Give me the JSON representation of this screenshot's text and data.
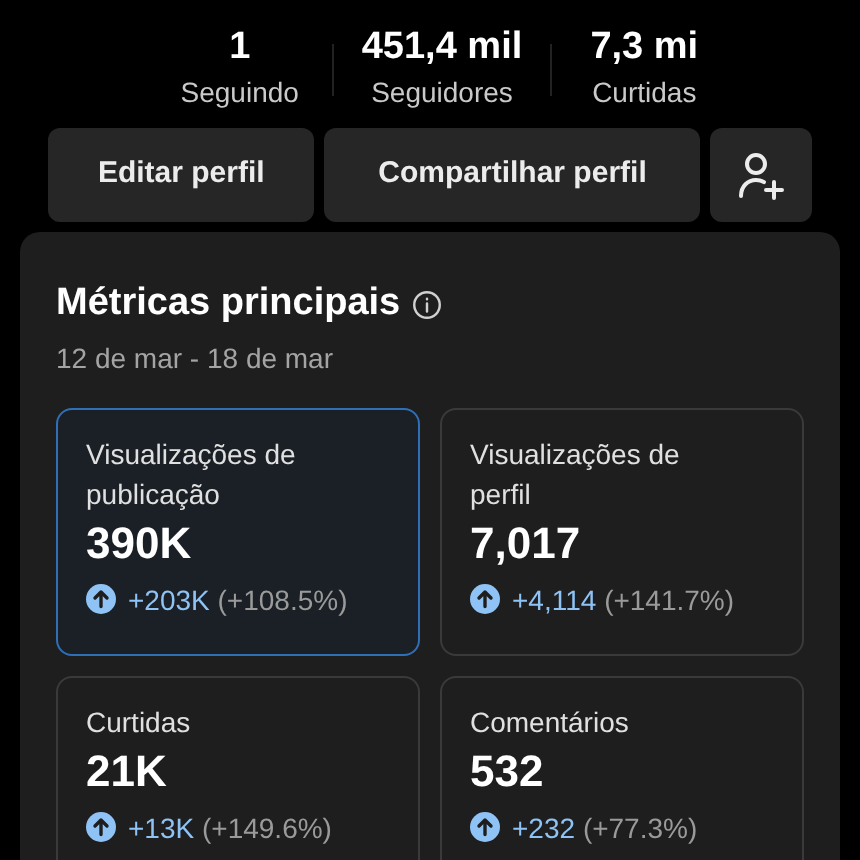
{
  "stats": [
    {
      "value": "1",
      "label": "Seguindo"
    },
    {
      "value": "451,4 mil",
      "label": "Seguidores"
    },
    {
      "value": "7,3 mi",
      "label": "Curtidas"
    }
  ],
  "buttons": [
    "Editar perfil",
    "Compartilhar perfil"
  ],
  "metrics_panel": {
    "title": "Métricas principais",
    "date_range": "12 de mar - 18 de mar",
    "metrics": [
      {
        "label": "Visualizações de publicação",
        "value": "390K",
        "change": "+203K",
        "percent": "(+108.5%)",
        "selected": true
      },
      {
        "label": "Visualizações de perfil",
        "value": "7,017",
        "change": "+4,114",
        "percent": "(+141.7%)",
        "selected": false
      },
      {
        "label": "Curtidas",
        "value": "21K",
        "change": "+13K",
        "percent": "(+149.6%)",
        "selected": false
      },
      {
        "label": "Comentários",
        "value": "532",
        "change": "+232",
        "percent": "(+77.3%)",
        "selected": false
      }
    ]
  }
}
